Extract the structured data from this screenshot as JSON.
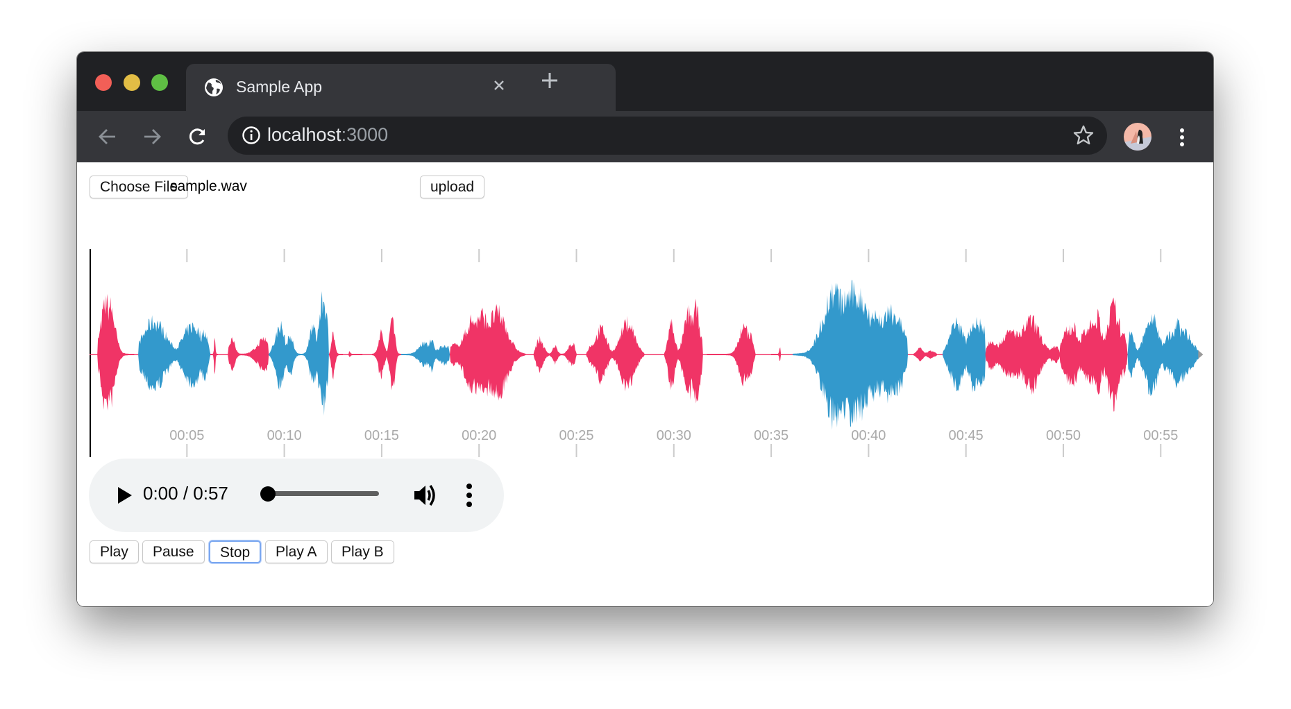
{
  "browser": {
    "tab_title": "Sample App",
    "url_host": "localhost",
    "url_port": ":3000",
    "icons": [
      "globe-icon",
      "close-icon",
      "plus-icon",
      "back-icon",
      "forward-icon",
      "reload-icon",
      "info-icon",
      "star-icon",
      "avatar",
      "more-vert-icon"
    ],
    "traffic_lights": {
      "close": "#f25f57",
      "minimize": "#e2bd45",
      "maximize": "#5fbf44"
    }
  },
  "file_input": {
    "button_label": "Choose File",
    "file_name": "sample.wav"
  },
  "upload_label": "upload",
  "waveform": {
    "duration_s": 57,
    "tick_interval_s": 5,
    "tick_labels": [
      "00:05",
      "00:10",
      "00:15",
      "00:20",
      "00:25",
      "00:30",
      "00:35",
      "00:40",
      "00:45",
      "00:50",
      "00:55"
    ],
    "colors": {
      "A": "#f03466",
      "B": "#3399cc",
      "gap": "#999999",
      "tick": "#cccccc",
      "label": "#aaaaaa"
    },
    "segments": [
      {
        "speaker": "A",
        "start": 0.4,
        "end": 2.3,
        "peak": 0.78
      },
      {
        "speaker": "B",
        "start": 2.5,
        "end": 6.2,
        "peak": 0.5
      },
      {
        "speaker": "A",
        "start": 6.2,
        "end": 6.6,
        "peak": 0.25
      },
      {
        "speaker": "A",
        "start": 7.1,
        "end": 9.2,
        "peak": 0.3
      },
      {
        "speaker": "B",
        "start": 9.2,
        "end": 10.9,
        "peak": 0.4
      },
      {
        "speaker": "B",
        "start": 10.9,
        "end": 12.3,
        "peak": 0.85
      },
      {
        "speaker": "A",
        "start": 12.3,
        "end": 13.0,
        "peak": 0.3
      },
      {
        "speaker": "A",
        "start": 13.3,
        "end": 14.0,
        "peak": 0.06
      },
      {
        "speaker": "A",
        "start": 14.5,
        "end": 16.0,
        "peak": 0.56
      },
      {
        "speaker": "B",
        "start": 16.0,
        "end": 18.5,
        "peak": 0.2
      },
      {
        "speaker": "A",
        "start": 18.5,
        "end": 22.4,
        "peak": 0.55
      },
      {
        "speaker": "A",
        "start": 22.8,
        "end": 25.0,
        "peak": 0.25
      },
      {
        "speaker": "A",
        "start": 25.5,
        "end": 28.5,
        "peak": 0.45
      },
      {
        "speaker": "A",
        "start": 29.5,
        "end": 31.5,
        "peak": 0.72
      },
      {
        "speaker": "A",
        "start": 31.7,
        "end": 34.2,
        "peak": 0.4
      },
      {
        "speaker": "A",
        "start": 35.0,
        "end": 35.5,
        "peak": 0.15
      },
      {
        "speaker": "B",
        "start": 36.1,
        "end": 42.0,
        "peak": 0.85
      },
      {
        "speaker": "A",
        "start": 42.3,
        "end": 43.5,
        "peak": 0.08
      },
      {
        "speaker": "B",
        "start": 43.8,
        "end": 46.0,
        "peak": 0.62
      },
      {
        "speaker": "A",
        "start": 46.0,
        "end": 49.8,
        "peak": 0.45
      },
      {
        "speaker": "A",
        "start": 49.8,
        "end": 53.3,
        "peak": 0.72
      },
      {
        "speaker": "B",
        "start": 53.3,
        "end": 57.0,
        "peak": 0.52
      }
    ]
  },
  "player": {
    "time": "0:00 / 0:57",
    "progress": 0,
    "icons": [
      "play-icon",
      "volume-icon",
      "more-vert-icon"
    ]
  },
  "controls": [
    {
      "label": "Play"
    },
    {
      "label": "Pause"
    },
    {
      "label": "Stop",
      "focused": true
    },
    {
      "label": "Play A"
    },
    {
      "label": "Play B"
    }
  ]
}
